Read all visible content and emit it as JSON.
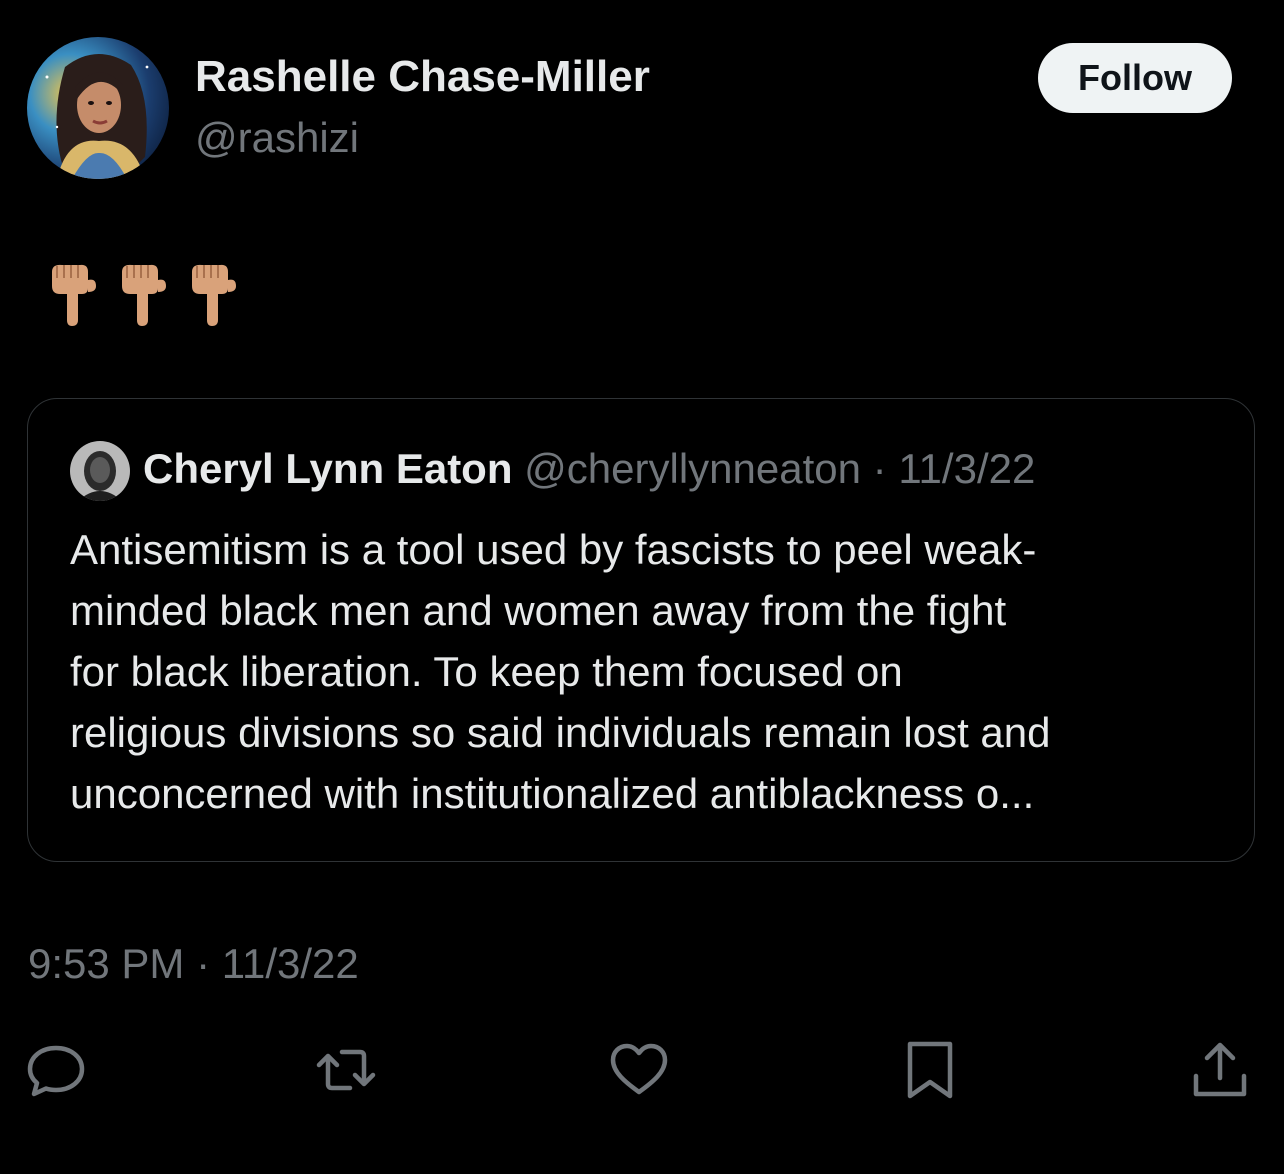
{
  "tweet": {
    "author": {
      "name": "Rashelle Chase-Miller",
      "handle": "@rashizi",
      "avatar_icon": "profile-photo"
    },
    "follow_label": "Follow",
    "body_emoji": [
      "👇🏽",
      "👇🏽",
      "👇🏽"
    ],
    "timestamp": "9:53 PM · 11/3/22"
  },
  "quoted_tweet": {
    "name": "Cheryl Lynn Eaton",
    "meta": "@cheryllynneaton · 11/3/22",
    "text": "Antisemitism is a tool used by fascists to peel weak-\nminded black men and women away from the fight\nfor black liberation. To keep them focused on\nreligious divisions so said individuals remain lost and\nunconcerned with institutionalized antiblackness o..."
  },
  "actions": [
    {
      "name": "reply",
      "icon": "reply-icon"
    },
    {
      "name": "retweet",
      "icon": "retweet-icon"
    },
    {
      "name": "like",
      "icon": "heart-icon"
    },
    {
      "name": "bookmark",
      "icon": "bookmark-icon"
    },
    {
      "name": "share",
      "icon": "share-icon"
    }
  ],
  "colors": {
    "background": "#000000",
    "primary_text": "#e7e9ea",
    "secondary_text": "#71767b",
    "border": "#2f3336",
    "follow_bg": "#eff3f4"
  }
}
